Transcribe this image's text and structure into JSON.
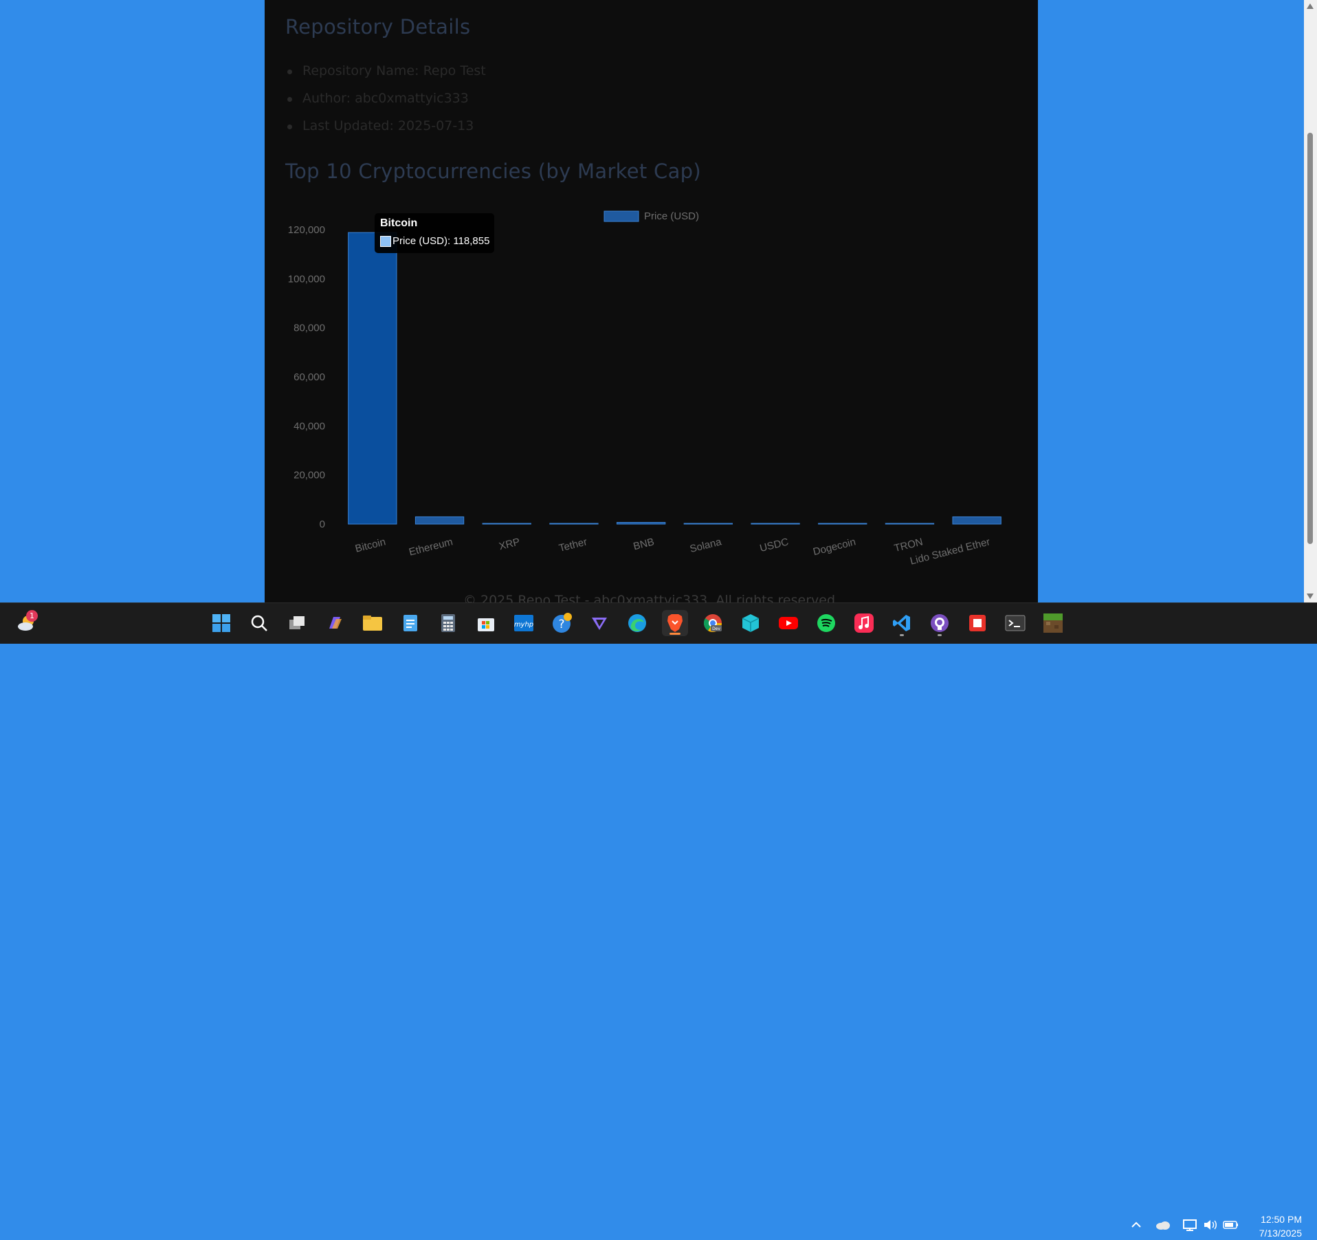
{
  "repo": {
    "heading": "Repository Details",
    "items": [
      "Repository Name: Repo Test",
      "Author: abc0xmattyic333",
      "Last Updated: 2025-07-13"
    ]
  },
  "chart_section": {
    "heading": "Top 10 Cryptocurrencies (by Market Cap)"
  },
  "chart_data": {
    "type": "bar",
    "title": "",
    "xlabel": "",
    "ylabel": "",
    "categories": [
      "Bitcoin",
      "Ethereum",
      "XRP",
      "Tether",
      "BNB",
      "Solana",
      "USDC",
      "Dogecoin",
      "TRON",
      "Lido Staked Ether"
    ],
    "series": [
      {
        "name": "Price (USD)",
        "values": [
          118855,
          2960,
          2.8,
          1,
          690,
          160,
          1,
          0.2,
          0.3,
          2950
        ]
      }
    ],
    "ylim": [
      0,
      120000
    ],
    "yticks": [
      "0",
      "20,000",
      "40,000",
      "60,000",
      "80,000",
      "100,000",
      "120,000"
    ],
    "legend_position": "top",
    "grid": false,
    "colors": {
      "bar": "#1f5aa0",
      "bar_active": "#0a4f9e",
      "border": "#3a83d6"
    }
  },
  "tooltip": {
    "title": "Bitcoin",
    "label": "Price (USD): 118,855"
  },
  "footer": {
    "text": "© 2025 Repo Test - abc0xmattyic333. All rights reserved."
  },
  "taskbar": {
    "weather_badge": "1",
    "apps": [
      "weather-widget",
      "start-menu",
      "search",
      "task-view",
      "copilot",
      "file-explorer",
      "notepad",
      "calculator",
      "microsoft-store",
      "myhp",
      "get-help",
      "proton-vpn",
      "edge",
      "brave",
      "chrome-dev",
      "sandbox",
      "youtube",
      "spotify",
      "apple-music",
      "vscode",
      "github-desktop",
      "office",
      "terminal",
      "minecraft"
    ],
    "time": "12:50 PM",
    "date": "7/13/2025"
  }
}
